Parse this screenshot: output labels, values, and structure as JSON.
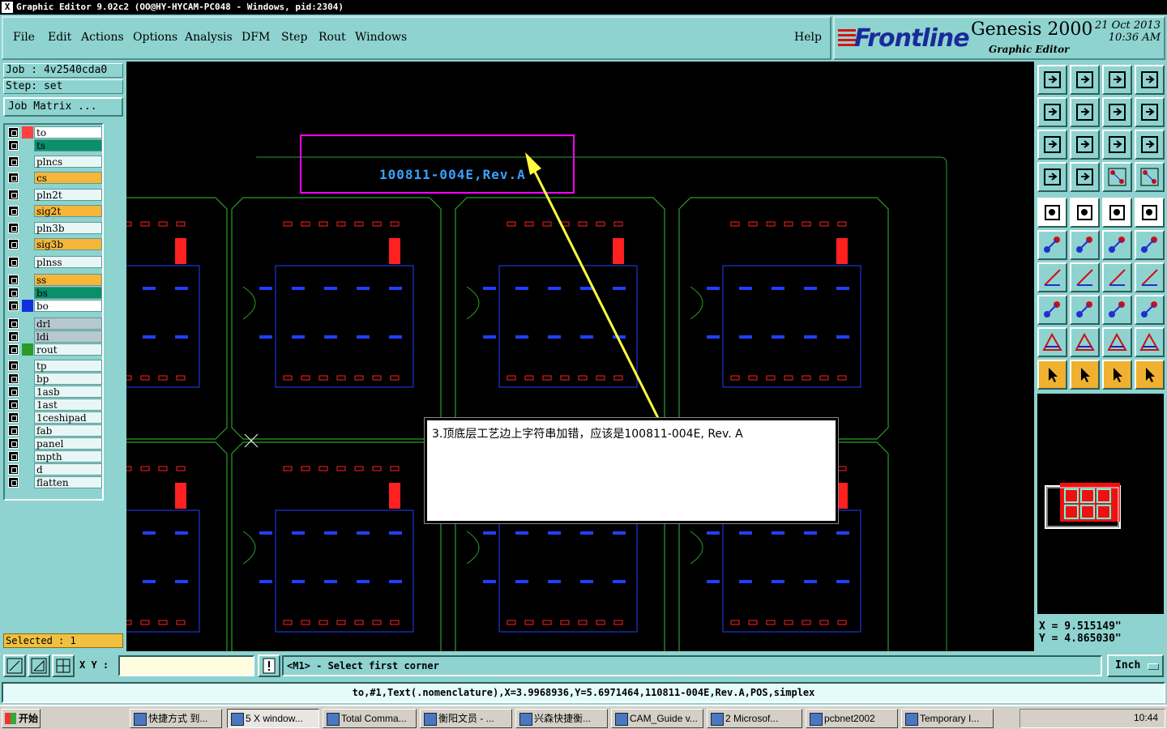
{
  "titlebar": {
    "text": "Graphic Editor 9.02c2 (OO@HY-HYCAM-PC048 - Windows, pid:2304)"
  },
  "menu": [
    "File",
    "Edit",
    "Actions",
    "Options",
    "Analysis",
    "DFM",
    "Step",
    "Rout",
    "Windows",
    "Help"
  ],
  "brand": {
    "logo": "Frontline",
    "product": "Genesis 2000",
    "subtitle": "Graphic Editor",
    "date": "21 Oct 2013",
    "time": "10:36 AM"
  },
  "job": {
    "job_label": "Job : 4v2540cda0",
    "step_label": "Step: set",
    "matrix_button": "Job Matrix ..."
  },
  "layers": [
    {
      "name": "to",
      "color": "#ffffff",
      "swatch": "#ff4040"
    },
    {
      "name": "ts",
      "color": "#0a8f6a",
      "swatch": ""
    },
    {
      "name": "plncs",
      "color": "#e8f7f6",
      "swatch": ""
    },
    {
      "name": "cs",
      "color": "#f5b63a",
      "swatch": ""
    },
    {
      "name": "pln2t",
      "color": "#e8f7f6",
      "swatch": ""
    },
    {
      "name": "sig2t",
      "color": "#f5b63a",
      "swatch": ""
    },
    {
      "name": "pln3b",
      "color": "#e8f7f6",
      "swatch": ""
    },
    {
      "name": "sig3b",
      "color": "#f5b63a",
      "swatch": ""
    },
    {
      "name": "plnss",
      "color": "#e8f7f6",
      "swatch": ""
    },
    {
      "name": "ss",
      "color": "#f5b63a",
      "swatch": ""
    },
    {
      "name": "bs",
      "color": "#0a8f6a",
      "swatch": ""
    },
    {
      "name": "bo",
      "color": "#ffffff",
      "swatch": "#1030e0"
    },
    {
      "name": "drl",
      "color": "#b8c8d0",
      "swatch": ""
    },
    {
      "name": "ldi",
      "color": "#b8c8d0",
      "swatch": ""
    },
    {
      "name": "rout",
      "color": "#e8f7f6",
      "swatch": "#2a9a2a"
    },
    {
      "name": "tp",
      "color": "#e8f7f6",
      "swatch": ""
    },
    {
      "name": "bp",
      "color": "#e8f7f6",
      "swatch": ""
    },
    {
      "name": "1asb",
      "color": "#e8f7f6",
      "swatch": ""
    },
    {
      "name": "1ast",
      "color": "#e8f7f6",
      "swatch": ""
    },
    {
      "name": "1ceshipad",
      "color": "#e8f7f6",
      "swatch": ""
    },
    {
      "name": "fab",
      "color": "#e8f7f6",
      "swatch": ""
    },
    {
      "name": "panel",
      "color": "#e8f7f6",
      "swatch": ""
    },
    {
      "name": "mpth",
      "color": "#e8f7f6",
      "swatch": ""
    },
    {
      "name": "d",
      "color": "#e8f7f6",
      "swatch": ""
    },
    {
      "name": "flatten",
      "color": "#e8f7f6",
      "swatch": ""
    }
  ],
  "selected": "Selected : 1",
  "canvas": {
    "board_text": "100811-004E,Rev.A",
    "annotation": "3.顶底层工艺边上字符串加错，应该是100811-004E, Rev. A"
  },
  "coords": {
    "x": "X = 9.515149\"",
    "y": "Y = 4.865030\""
  },
  "cmd": {
    "xy_label": "X Y :",
    "xy_value": "",
    "prompt": "<M1> - Select first corner",
    "units": "Inch"
  },
  "status": "to,#1,Text(.nomenclature),X=3.9968936,Y=5.6971464,110811-004E,Rev.A,POS,simplex",
  "taskbar": {
    "start": "开始",
    "tasks": [
      "快捷方式 到...",
      "5 X window...",
      "Total Comma...",
      "衡阳文员 - ...",
      "兴森快捷衡...",
      "CAM_Guide v...",
      "2 Microsof...",
      "pcbnet2002",
      "Temporary I..."
    ],
    "clock": "10:44"
  },
  "colors": {
    "panel": "#8ed3cf",
    "canvas": "#000000",
    "highlight": "#ff00ff",
    "arrow": "#ffff40",
    "pad": "#ff2020",
    "silk": "#2040ff",
    "outline": "#28a028"
  }
}
